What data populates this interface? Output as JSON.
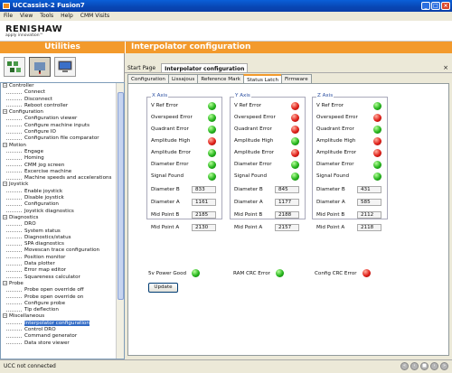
{
  "window": {
    "title": "UCCassist-2 Fusion7"
  },
  "menu": [
    "File",
    "View",
    "Tools",
    "Help",
    "CMM Visits"
  ],
  "brand": {
    "name": "RENISHAW",
    "tagline": "apply innovation™"
  },
  "left_header": "Utilities",
  "right_header": "Interpolator configuration",
  "toolbar": {
    "icons": [
      "machine-icon",
      "probe-icon",
      "computer-icon"
    ]
  },
  "tree": [
    {
      "label": "Controller",
      "items": [
        "Connect",
        "Disconnect",
        "Reboot controller"
      ]
    },
    {
      "label": "Configuration",
      "items": [
        "Configuration viewer",
        "Configure machine inputs",
        "Configure IO",
        "Configuration file comparator"
      ]
    },
    {
      "label": "Motion",
      "items": [
        "Engage",
        "Homing",
        "CMM jog screen",
        "Excercise machine",
        "Machine speeds and accelerations"
      ]
    },
    {
      "label": "Joystick",
      "items": [
        "Enable joystick",
        "Disable joystick",
        "Configuration",
        "Joystick diagnostics"
      ]
    },
    {
      "label": "Diagnostics",
      "items": [
        "DRO",
        "System status",
        "Diagnostics/status",
        "SPA diagnostics",
        "Movescan trace configuration",
        "Position monitor",
        "Data plotter",
        "Error map editor",
        "Squareness calculator"
      ]
    },
    {
      "label": "Probe",
      "items": [
        "Probe open override off",
        "Probe open override on",
        "Configure probe",
        "Tip deflection"
      ]
    },
    {
      "label": "Miscellaneous",
      "items": [
        "Interpolator configuration",
        "Control DRO",
        "Command generator",
        "Data store viewer"
      ]
    }
  ],
  "selected_item": "Interpolator configuration",
  "crumbs": {
    "start": "Start Page",
    "current": "Interpolator configuration",
    "close": "×"
  },
  "tabs": [
    "Configuration",
    "Lissajous",
    "Reference Mark",
    "Status Latch",
    "Firmware"
  ],
  "active_tab": "Status Latch",
  "labels": {
    "status": [
      "V Ref Error",
      "Overspeed Error",
      "Quadrant Error",
      "Amplitude High",
      "Amplitude Error",
      "Diameter Error",
      "Signal Found"
    ],
    "values": [
      "Diameter B",
      "Diameter A",
      "Mid Point B",
      "Mid Point A"
    ]
  },
  "axes": [
    {
      "name": "X Axis",
      "leds": [
        "green",
        "green",
        "green",
        "red",
        "green",
        "green",
        "green"
      ],
      "values": [
        "833",
        "1161",
        "2185",
        "2130"
      ]
    },
    {
      "name": "Y Axis",
      "leds": [
        "red",
        "red",
        "red",
        "green",
        "red",
        "green",
        "green"
      ],
      "values": [
        "845",
        "1177",
        "2188",
        "2157"
      ]
    },
    {
      "name": "Z Axis",
      "leds": [
        "green",
        "red",
        "green",
        "red",
        "red",
        "green",
        "green"
      ],
      "values": [
        "431",
        "585",
        "2112",
        "2118"
      ]
    }
  ],
  "extras": [
    {
      "label": "5v Power Good",
      "led": "green"
    },
    {
      "label": "RAM CRC Error",
      "led": "green"
    },
    {
      "label": "Config CRC Error",
      "led": "red"
    }
  ],
  "update_button": "Update",
  "status": {
    "text": "UCC not connected"
  }
}
